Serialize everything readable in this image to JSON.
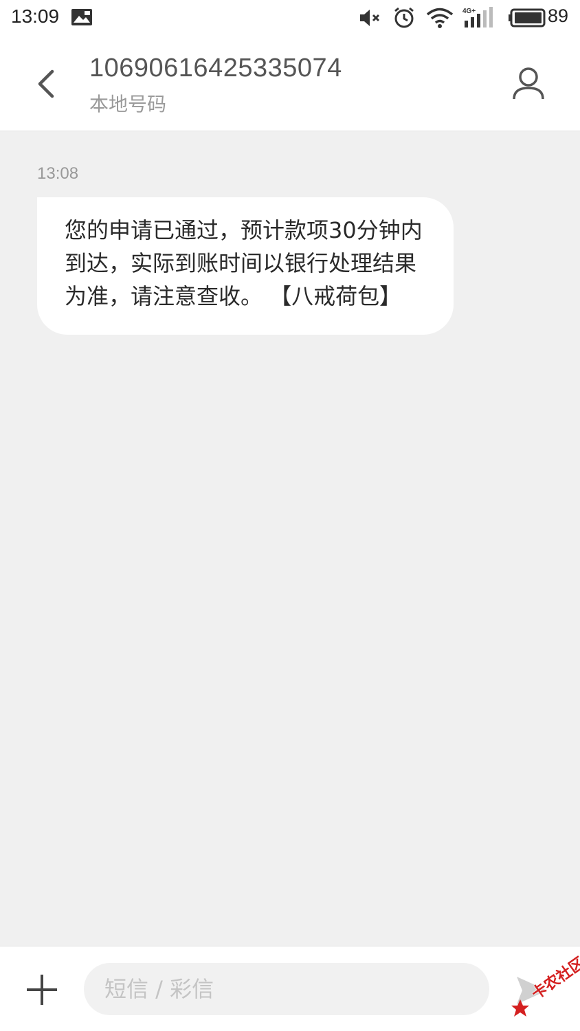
{
  "status_bar": {
    "time": "13:09",
    "battery_level": "89",
    "icons": [
      "picture-icon",
      "mute-icon",
      "alarm-icon",
      "wifi-icon",
      "signal-4g-icon",
      "battery-icon"
    ],
    "network_label": "4G+"
  },
  "header": {
    "contact_number": "10690616425335074",
    "contact_subtitle": "本地号码",
    "back_icon": "chevron-left-icon",
    "contact_icon": "person-icon"
  },
  "conversation": {
    "messages": [
      {
        "timestamp": "13:08",
        "text": "您的申请已通过，预计款项30分钟内到达，实际到账时间以银行处理结果为准，请注意查收。 【八戒荷包】"
      }
    ]
  },
  "input_bar": {
    "placeholder": "短信 / 彩信",
    "add_icon": "plus-icon",
    "send_icon": "send-icon"
  },
  "watermark": {
    "text": "卡农社区"
  },
  "colors": {
    "background": "#f0f0f0",
    "bubble": "#ffffff",
    "watermark": "#d42020"
  }
}
